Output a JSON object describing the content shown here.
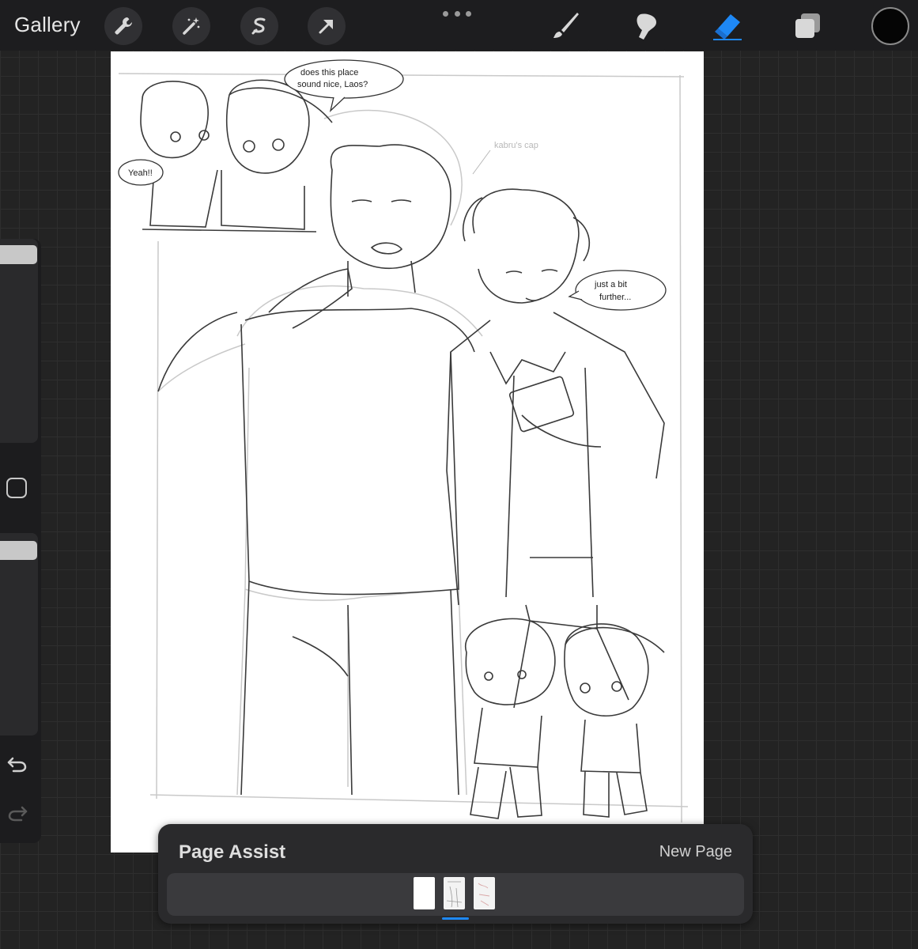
{
  "topbar": {
    "gallery_label": "Gallery",
    "tools_left": [
      "wrench-icon",
      "magic-wand-icon",
      "selection-icon",
      "transform-arrow-icon"
    ],
    "tools_right": [
      "brush-icon",
      "smudge-icon",
      "eraser-icon",
      "layers-icon"
    ],
    "active_tool": "eraser-icon",
    "active_tool_color": "#1e88f5",
    "current_color": "#050505"
  },
  "sidebar": {
    "brush_size_level": 0.0,
    "opacity_level": 0.0,
    "icons": [
      "square-modify-icon",
      "undo-icon",
      "redo-icon"
    ]
  },
  "canvas": {
    "bubbles": {
      "top": [
        "does this place",
        "sound nice, Laos?"
      ],
      "left": [
        "Yeah!!"
      ],
      "right": [
        "just a bit",
        "further..."
      ],
      "note": "kabru's cap"
    }
  },
  "page_assist": {
    "title": "Page Assist",
    "new_page_label": "New Page",
    "pages": [
      "page-1",
      "page-2",
      "page-3"
    ],
    "selected_page_index": 1
  }
}
